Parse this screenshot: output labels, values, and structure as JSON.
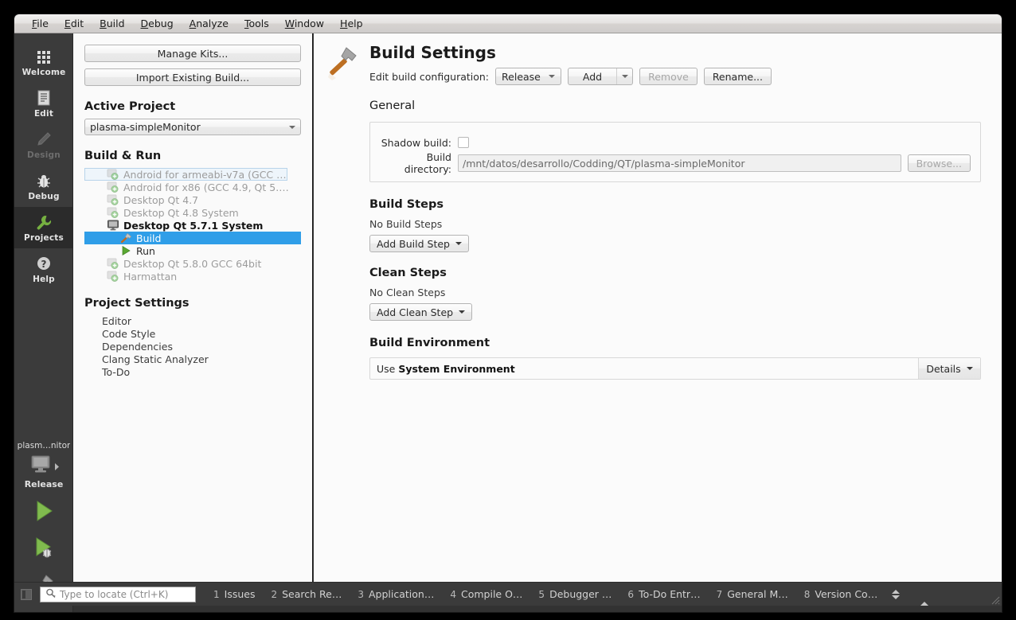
{
  "menubar": {
    "items": [
      {
        "label": "File",
        "mnemonic": "F"
      },
      {
        "label": "Edit",
        "mnemonic": "E"
      },
      {
        "label": "Build",
        "mnemonic": "B"
      },
      {
        "label": "Debug",
        "mnemonic": "D"
      },
      {
        "label": "Analyze",
        "mnemonic": "A"
      },
      {
        "label": "Tools",
        "mnemonic": "T"
      },
      {
        "label": "Window",
        "mnemonic": "W"
      },
      {
        "label": "Help",
        "mnemonic": "H"
      }
    ]
  },
  "modebar": {
    "modes": [
      {
        "label": "Welcome",
        "icon": "grid-icon",
        "state": "enabled"
      },
      {
        "label": "Edit",
        "icon": "document-icon",
        "state": "enabled"
      },
      {
        "label": "Design",
        "icon": "pencil-icon",
        "state": "disabled"
      },
      {
        "label": "Debug",
        "icon": "bug-icon",
        "state": "enabled"
      },
      {
        "label": "Projects",
        "icon": "wrench-icon",
        "state": "active"
      },
      {
        "label": "Help",
        "icon": "question-mark-icon",
        "state": "enabled"
      }
    ],
    "kit_selector": {
      "project_name": "plasm…nitor",
      "config_name": "Release",
      "icon": "desktop-monitor-icon",
      "arrow": "chevron-right-icon"
    },
    "actions": [
      {
        "name": "run-button",
        "icon": "play-triangle-icon"
      },
      {
        "name": "debug-button",
        "icon": "play-with-bug-icon"
      },
      {
        "name": "build-button",
        "icon": "hammer-icon"
      }
    ]
  },
  "project_panel": {
    "manage_kits_label": "Manage Kits...",
    "import_existing_label": "Import Existing Build...",
    "active_project_heading": "Active Project",
    "active_project_value": "plasma-simpleMonitor",
    "build_run_heading": "Build & Run",
    "kits": [
      {
        "label": "Android for armeabi-v7a (GCC …",
        "icon": "kit-add-icon",
        "state": "dim",
        "indent": "normal",
        "focused": true
      },
      {
        "label": "Android for x86 (GCC 4.9, Qt 5.…",
        "icon": "kit-add-icon",
        "state": "dim",
        "indent": "normal",
        "focused": false
      },
      {
        "label": "Desktop Qt 4.7",
        "icon": "kit-add-icon",
        "state": "dim",
        "indent": "normal",
        "focused": false
      },
      {
        "label": "Desktop Qt 4.8 System",
        "icon": "kit-add-icon",
        "state": "dim",
        "indent": "normal",
        "focused": false
      },
      {
        "label": "Desktop Qt 5.7.1 System",
        "icon": "desktop-monitor-icon",
        "state": "bold",
        "indent": "normal",
        "focused": false
      },
      {
        "label": "Build",
        "icon": "hammer-icon",
        "state": "selected",
        "indent": "child",
        "focused": false
      },
      {
        "label": "Run",
        "icon": "play-triangle-icon",
        "state": "normal",
        "indent": "child",
        "focused": false
      },
      {
        "label": "Desktop Qt 5.8.0 GCC 64bit",
        "icon": "kit-add-icon",
        "state": "dim",
        "indent": "normal",
        "focused": false
      },
      {
        "label": "Harmattan",
        "icon": "kit-add-icon",
        "state": "dim",
        "indent": "normal",
        "focused": false
      }
    ],
    "project_settings_heading": "Project Settings",
    "settings_items": [
      "Editor",
      "Code Style",
      "Dependencies",
      "Clang Static Analyzer",
      "To-Do"
    ]
  },
  "build_settings": {
    "title": "Build Settings",
    "icon": "hammer-icon",
    "edit_config_label": "Edit build configuration:",
    "config_value": "Release",
    "add_label": "Add",
    "remove_label": "Remove",
    "remove_enabled": false,
    "rename_label": "Rename...",
    "general": {
      "heading": "General",
      "shadow_build_label": "Shadow build:",
      "shadow_build_checked": false,
      "build_directory_label": "Build directory:",
      "build_directory_value": "/mnt/datos/desarrollo/Codding/QT/plasma-simpleMonitor",
      "browse_label": "Browse...",
      "browse_enabled": false
    },
    "build_steps": {
      "heading": "Build Steps",
      "empty_text": "No Build Steps",
      "add_label": "Add Build Step"
    },
    "clean_steps": {
      "heading": "Clean Steps",
      "empty_text": "No Clean Steps",
      "add_label": "Add Clean Step"
    },
    "build_environment": {
      "heading": "Build Environment",
      "use_prefix": "Use",
      "environment_name": "System Environment",
      "details_label": "Details"
    }
  },
  "statusbar": {
    "sidebar_toggle_icon": "panel-toggle-icon",
    "locator_placeholder": "Type to locate (Ctrl+K)",
    "locator_icon": "search-icon",
    "panes": [
      {
        "num": "1",
        "label": "Issues"
      },
      {
        "num": "2",
        "label": "Search Re…"
      },
      {
        "num": "3",
        "label": "Application…"
      },
      {
        "num": "4",
        "label": "Compile O…"
      },
      {
        "num": "5",
        "label": "Debugger …"
      },
      {
        "num": "6",
        "label": "To-Do Entr…"
      },
      {
        "num": "7",
        "label": "General M…"
      },
      {
        "num": "8",
        "label": "Version Co…"
      }
    ]
  },
  "colors": {
    "selection_blue": "#2f9ee8",
    "mode_bar_bg": "#3b3b3b",
    "mode_active_bg": "#2b2b2b",
    "panel_bg": "#fafafa",
    "accent_green": "#76b041",
    "hammer_handle": "#c1691f"
  }
}
